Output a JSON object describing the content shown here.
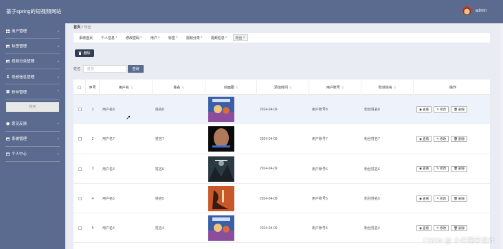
{
  "header": {
    "app_title": "基于spring的短视频网站",
    "username": "admin"
  },
  "sidebar": {
    "items": [
      {
        "label": "用户管理",
        "icon": "grid-icon"
      },
      {
        "label": "标签管理",
        "icon": "image-icon"
      },
      {
        "label": "视频分类管理",
        "icon": "image-icon"
      },
      {
        "label": "视频信息管理",
        "icon": "user-icon"
      },
      {
        "label": "粉丝管理",
        "icon": "document-icon"
      },
      {
        "label": "意见反馈",
        "icon": "shield-icon"
      },
      {
        "label": "系统管理",
        "icon": "image-icon"
      },
      {
        "label": "个人中心",
        "icon": "calendar-icon"
      }
    ],
    "submenu_item": "粉丝"
  },
  "breadcrumb": {
    "home": "首页",
    "separator": "//",
    "current": "粉丝"
  },
  "tabs": [
    {
      "label": "系统首页",
      "closable": false,
      "active": false
    },
    {
      "label": "个人信息",
      "closable": true,
      "active": false
    },
    {
      "label": "修改密码",
      "closable": true,
      "active": false
    },
    {
      "label": "用户",
      "closable": true,
      "active": false
    },
    {
      "label": "标签",
      "closable": true,
      "active": false
    },
    {
      "label": "视频分类",
      "closable": true,
      "active": false
    },
    {
      "label": "视频信息",
      "closable": true,
      "active": false
    },
    {
      "label": "粉丝",
      "closable": true,
      "active": true
    }
  ],
  "toolbar": {
    "delete_label": "删除"
  },
  "search": {
    "label": "姓名",
    "placeholder": "姓名",
    "button_label": "查询"
  },
  "table": {
    "headers": [
      "序号",
      "用户名",
      "姓名",
      "封面图",
      "添加时间",
      "用户账号",
      "粉丝姓名",
      "操作"
    ],
    "rows": [
      {
        "idx": "1",
        "username": "用户名8",
        "name": "姓名8",
        "date": "2024-04-09",
        "account": "用户账号8",
        "fan_name": "粉丝姓名8",
        "cover": "blue-sky-poster"
      },
      {
        "idx": "2",
        "username": "用户名7",
        "name": "姓名7",
        "date": "2024-04-09",
        "account": "用户账号7",
        "fan_name": "粉丝姓名7",
        "cover": "face-poster"
      },
      {
        "idx": "3",
        "username": "用户名6",
        "name": "姓名6",
        "date": "2024-04-09",
        "account": "用户账号6",
        "fan_name": "粉丝姓名6",
        "cover": "dark-forest-poster"
      },
      {
        "idx": "4",
        "username": "用户名5",
        "name": "姓名5",
        "date": "2024-04-09",
        "account": "用户账号5",
        "fan_name": "粉丝姓名5",
        "cover": "orange-dragon-poster"
      },
      {
        "idx": "5",
        "username": "用户名4",
        "name": "姓名4",
        "date": "2024-04-09",
        "account": "用户账号4",
        "fan_name": "粉丝姓名4",
        "cover": "blue-sky-poster"
      }
    ],
    "actions": {
      "view": "查看",
      "edit": "修改",
      "delete": "删除"
    }
  },
  "watermark": "CSDN @ 小许程序设计",
  "colors": {
    "sidebar": "#5b6b8f",
    "header": "#5b6b8f",
    "primary_button": "#2f3e53"
  }
}
